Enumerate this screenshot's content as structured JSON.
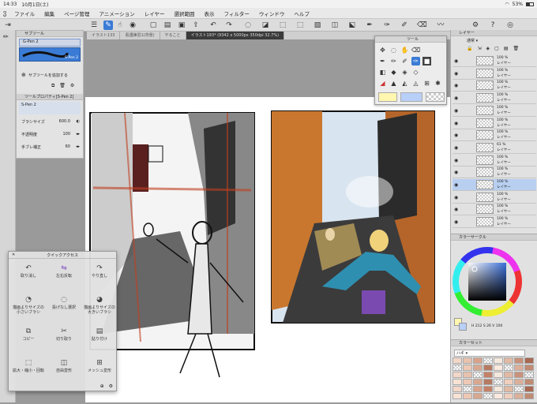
{
  "status": {
    "time": "14:33",
    "date": "10月1日(土)",
    "battery": "53%"
  },
  "menu": [
    "ファイル",
    "編集",
    "ページ管理",
    "アニメーション",
    "レイヤー",
    "選択範囲",
    "表示",
    "フィルター",
    "ウィンドウ",
    "ヘルプ"
  ],
  "tabs": [
    {
      "label": "イラスト133",
      "active": false
    },
    {
      "label": "看護練習1(背景)",
      "active": false
    },
    {
      "label": "やること",
      "active": false
    },
    {
      "label": "イラスト193* (9342 x 5000px 350dpi 32.7%)",
      "active": true
    }
  ],
  "subtool": {
    "title": "サブツール",
    "brush_name": "G-Pen 2",
    "brush_name2": "S-Pen 2",
    "add_label": "サブツールを追加する"
  },
  "toolprop": {
    "title": "ツールプロパティ[S-Pen 2]",
    "brush": "S-Pen 2",
    "size_label": "ブラシサイズ",
    "size_value": "600.0",
    "opacity_label": "不透明度",
    "opacity_value": "100",
    "stab_label": "手ブレ補正",
    "stab_value": "60"
  },
  "tool_palette": {
    "title": "ツール"
  },
  "layers_panel": {
    "title": "レイヤー",
    "blend": "通常",
    "rows": [
      {
        "pct": "100 %",
        "name": "レイヤー"
      },
      {
        "pct": "100 %",
        "name": "レイヤー"
      },
      {
        "pct": "100 %",
        "name": "レイヤー"
      },
      {
        "pct": "100 %",
        "name": "レイヤー"
      },
      {
        "pct": "100 %",
        "name": "レイヤー"
      },
      {
        "pct": "100 %",
        "name": "レイヤー"
      },
      {
        "pct": "100 %",
        "name": "レイヤー"
      },
      {
        "pct": "61 %",
        "name": "レイヤー"
      },
      {
        "pct": "100 %",
        "name": "レイヤー"
      },
      {
        "pct": "100 %",
        "name": "レイヤー"
      },
      {
        "pct": "100 %",
        "name": "レイヤー"
      },
      {
        "pct": "100 %",
        "name": "レイヤー"
      },
      {
        "pct": "100 %",
        "name": "レイヤー"
      },
      {
        "pct": "100 %",
        "name": "レイヤー"
      }
    ]
  },
  "color_circle": {
    "title": "カラーサークル",
    "values": "H 212  S 26  V 100"
  },
  "color_set": {
    "title": "カラーセット",
    "name": "ハギ"
  },
  "quick_access": {
    "title": "クイックアクセス",
    "items": [
      {
        "label": "取り消し",
        "icon": "undo-icon"
      },
      {
        "label": "左右反転",
        "icon": "flip-icon"
      },
      {
        "label": "やり直し",
        "icon": "redo-icon"
      },
      {
        "label": "描画よりサイズの小さいブラシ",
        "icon": "brush-small-icon"
      },
      {
        "label": "投げなし選択",
        "icon": "lasso-icon"
      },
      {
        "label": "描画よりサイズの大きいブラシ",
        "icon": "brush-large-icon"
      },
      {
        "label": "コピー",
        "icon": "copy-icon"
      },
      {
        "label": "切り取り",
        "icon": "cut-icon"
      },
      {
        "label": "貼り付け",
        "icon": "paste-icon"
      },
      {
        "label": "拡大・縮小・回転",
        "icon": "transform-icon"
      },
      {
        "label": "自由変形",
        "icon": "free-transform-icon"
      },
      {
        "label": "メッシュ変形",
        "icon": "mesh-icon"
      }
    ]
  },
  "colors": {
    "accent": "#3a7bd5",
    "main_color": "#2f3f66",
    "sub_color": "#ffffff"
  }
}
